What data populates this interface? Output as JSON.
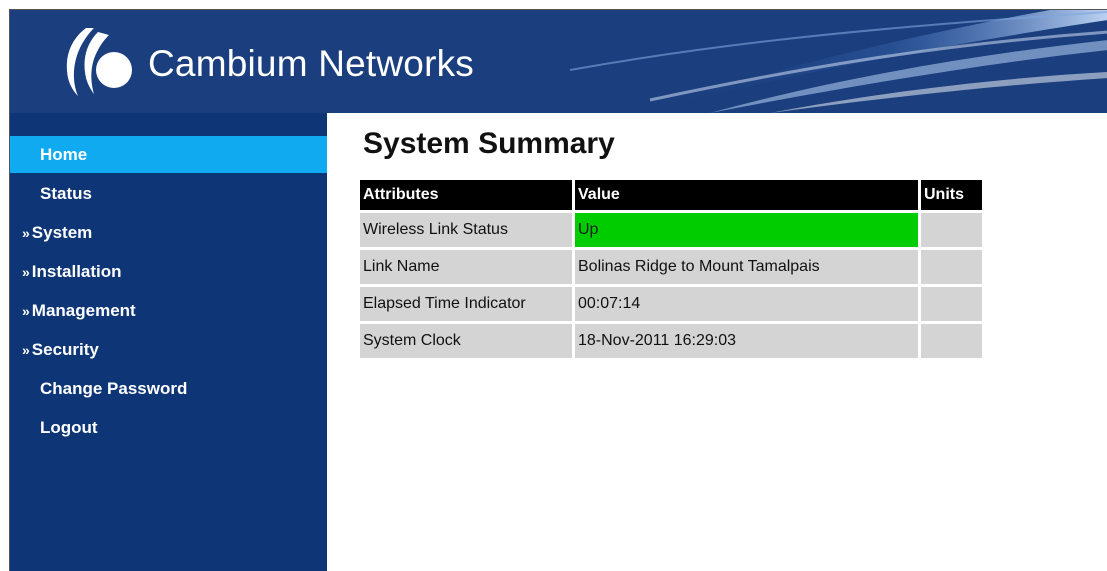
{
  "brand": {
    "name": "Cambium Networks",
    "logo_icon": "cambium-logo-icon"
  },
  "colors": {
    "header": "#1a3e7e",
    "sidebar": "#0e3575",
    "active": "#10aaf0",
    "status_up": "#00cc00"
  },
  "nav": {
    "items": [
      {
        "label": "Home",
        "prefix": "",
        "active": true
      },
      {
        "label": "Status",
        "prefix": ""
      },
      {
        "label": "System",
        "prefix": "»"
      },
      {
        "label": "Installation",
        "prefix": "»"
      },
      {
        "label": "Management",
        "prefix": "»"
      },
      {
        "label": "Security",
        "prefix": "»"
      },
      {
        "label": "Change Password",
        "prefix": ""
      },
      {
        "label": "Logout",
        "prefix": ""
      }
    ]
  },
  "main": {
    "title": "System Summary",
    "columns": [
      "Attributes",
      "Value",
      "Units"
    ],
    "rows": [
      {
        "attribute": "Wireless Link Status",
        "value": "Up",
        "units": ""
      },
      {
        "attribute": "Link Name",
        "value": "Bolinas Ridge to Mount Tamalpais",
        "units": ""
      },
      {
        "attribute": "Elapsed Time Indicator",
        "value": "00:07:14",
        "units": ""
      },
      {
        "attribute": "System Clock",
        "value": "18-Nov-2011 16:29:03",
        "units": ""
      }
    ]
  }
}
